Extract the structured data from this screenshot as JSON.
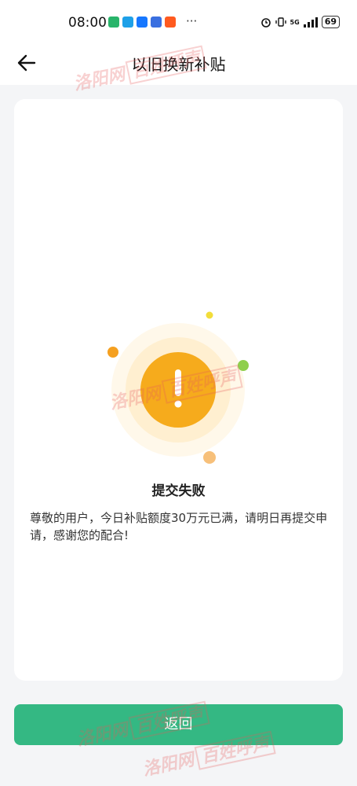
{
  "status_bar": {
    "time": "08:00",
    "more": "···",
    "network": "5G",
    "battery": "69"
  },
  "header": {
    "title": "以旧换新补贴",
    "back_icon": "arrow-left-icon"
  },
  "result": {
    "icon": "exclamation-icon",
    "title": "提交失败",
    "message": "尊敬的用户，今日补贴额度30万元已满，请明日再提交申请，感谢您的配合!"
  },
  "actions": {
    "return_label": "返回"
  },
  "watermark": {
    "left": "洛阳网",
    "right": "百姓呼声"
  },
  "colors": {
    "primary": "#34b883",
    "warning": "#f5a91a"
  }
}
